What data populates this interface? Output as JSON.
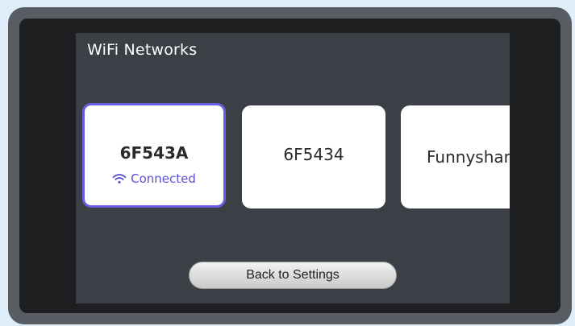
{
  "screen": {
    "title": "WiFi Networks"
  },
  "networks": [
    {
      "name": "6F543A",
      "status": "Connected",
      "status_icon": "wifi-icon",
      "selected": true
    },
    {
      "name": "6F5434",
      "status": "",
      "selected": false
    },
    {
      "name": "Funnyshar",
      "status": "",
      "selected": false
    }
  ],
  "back_button": {
    "label": "Back to Settings"
  },
  "colors": {
    "accent": "#6a5ee0",
    "screen_bg": "#3b4047",
    "card_bg": "#ffffff"
  }
}
